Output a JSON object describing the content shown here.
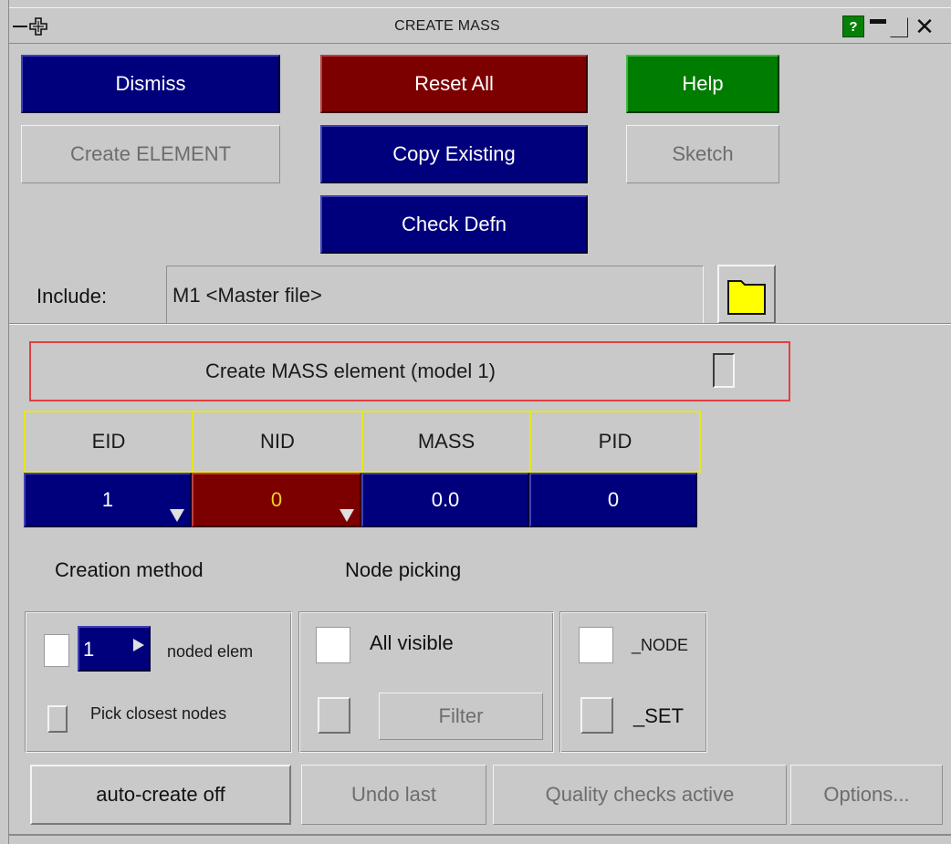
{
  "window": {
    "title": "CREATE MASS",
    "help_label": "?"
  },
  "top_buttons": {
    "dismiss": "Dismiss",
    "reset_all": "Reset All",
    "help": "Help",
    "create_element": "Create ELEMENT",
    "copy_existing": "Copy Existing",
    "sketch": "Sketch",
    "check_defn": "Check Defn"
  },
  "include": {
    "label": "Include:",
    "value": "M1  <Master file>"
  },
  "create_header": "Create MASS element (model 1)",
  "table": {
    "headers": [
      "EID",
      "NID",
      "MASS",
      "PID"
    ],
    "values": [
      "1",
      "0",
      "0.0",
      "0"
    ]
  },
  "sections": {
    "creation_method": "Creation method",
    "node_picking": "Node picking"
  },
  "creation": {
    "noded_count": "1",
    "noded_label": "noded elem",
    "pick_closest": "Pick closest nodes"
  },
  "picking": {
    "all_visible": "All visible",
    "filter": "Filter"
  },
  "types": {
    "node": "_NODE",
    "set": "_SET"
  },
  "bottom_buttons": {
    "auto_create": "auto-create off",
    "undo_last": "Undo last",
    "quality_checks": "Quality checks active",
    "options": "Options..."
  },
  "colors": {
    "panel": "#c9c9c9",
    "blue": "#00007c",
    "red": "#7c0000",
    "green": "#007c00",
    "header_border": "#e6e61e",
    "highlight_border": "#e04040",
    "folder": "#ffff00"
  },
  "icons": [
    "minimize-dash-icon",
    "move-cross-icon",
    "help-icon",
    "minimize-icon",
    "maximize-icon",
    "close-icon",
    "folder-icon",
    "dropdown-arrow-icon",
    "spin-arrow-icon"
  ]
}
